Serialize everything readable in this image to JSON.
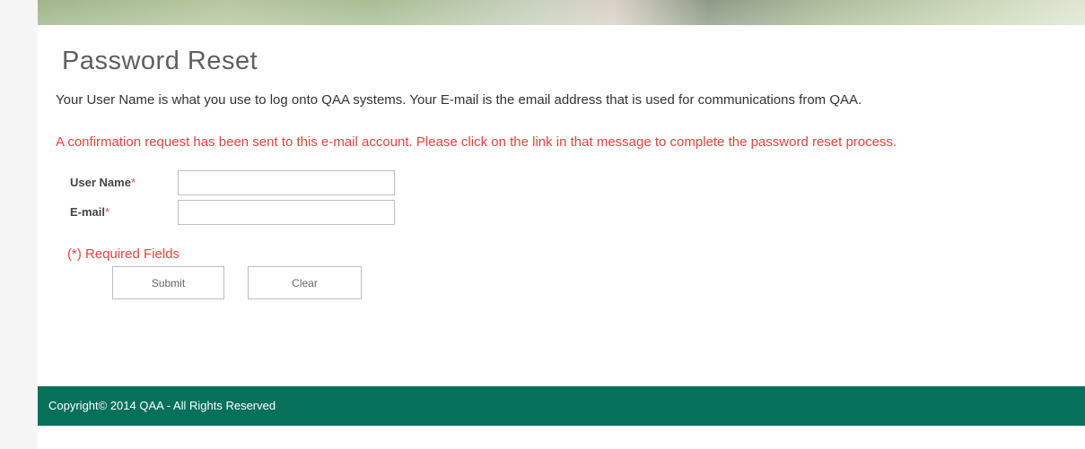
{
  "page": {
    "title": "Password Reset",
    "intro_text": "Your User Name is what you use to log onto QAA systems. Your E-mail is the email address that is used for communications from QAA.",
    "confirmation_message": "A confirmation request has been sent to this e-mail account. Please click on the link in that message to complete the password reset process."
  },
  "form": {
    "username_label": "User Name",
    "username_required_mark": "*",
    "username_value": "",
    "email_label": "E-mail",
    "email_required_mark": "*",
    "email_value": "",
    "required_note": "(*) Required Fields",
    "submit_label": "Submit",
    "clear_label": "Clear"
  },
  "footer": {
    "copyright": "Copyright© 2014 QAA - All Rights Reserved"
  },
  "colors": {
    "error_red": "#e8413f",
    "footer_green": "#07715c"
  }
}
